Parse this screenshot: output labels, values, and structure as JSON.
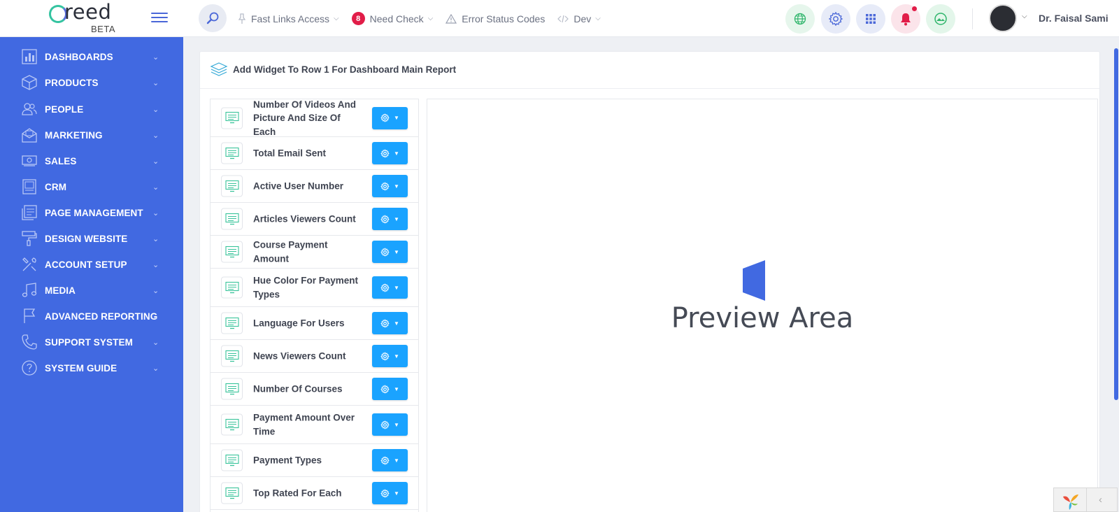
{
  "app": {
    "logo_text": "reed",
    "logo_badge": "BETA"
  },
  "topnav": {
    "items": [
      {
        "label": "Fast Links Access",
        "icon": "pin-icon"
      },
      {
        "label": "Need Check",
        "icon": "badge",
        "badge": "8"
      },
      {
        "label": "Error Status Codes",
        "icon": "warning-icon"
      },
      {
        "label": "Dev",
        "icon": "code-icon"
      }
    ],
    "user_name": "Dr. Faisal Sami"
  },
  "sidebar": {
    "items": [
      {
        "label": "DASHBOARDS",
        "icon": "chart-icon"
      },
      {
        "label": "PRODUCTS",
        "icon": "box-icon"
      },
      {
        "label": "PEOPLE",
        "icon": "people-icon"
      },
      {
        "label": "MARKETING",
        "icon": "envelope-icon"
      },
      {
        "label": "SALES",
        "icon": "money-icon"
      },
      {
        "label": "CRM",
        "icon": "screen-icon"
      },
      {
        "label": "PAGE MANAGEMENT",
        "icon": "page-icon"
      },
      {
        "label": "DESIGN WEBSITE",
        "icon": "roller-icon"
      },
      {
        "label": "ACCOUNT SETUP",
        "icon": "tools-icon"
      },
      {
        "label": "MEDIA",
        "icon": "music-icon"
      },
      {
        "label": "ADVANCED REPORTING",
        "icon": "flag-icon"
      },
      {
        "label": "SUPPORT SYSTEM",
        "icon": "phone-icon"
      },
      {
        "label": "SYSTEM GUIDE",
        "icon": "help-icon"
      }
    ]
  },
  "card": {
    "title": "Add Widget To Row 1 For Dashboard Main Report"
  },
  "widgets": [
    {
      "label": "Number Of Videos And Picture And Size Of Each"
    },
    {
      "label": "Total Email Sent"
    },
    {
      "label": "Active User Number"
    },
    {
      "label": "Articles Viewers Count"
    },
    {
      "label": "Course Payment Amount"
    },
    {
      "label": "Hue Color For Payment Types"
    },
    {
      "label": "Language For Users"
    },
    {
      "label": "News Viewers Count"
    },
    {
      "label": "Number Of Courses"
    },
    {
      "label": "Payment Amount Over Time"
    },
    {
      "label": "Payment Types"
    },
    {
      "label": "Top Rated For Each"
    }
  ],
  "preview": {
    "text": "Preview Area"
  },
  "colors": {
    "sidebar": "#4169e1",
    "accent_button": "#1aa3ff",
    "badge": "#e11d48"
  }
}
